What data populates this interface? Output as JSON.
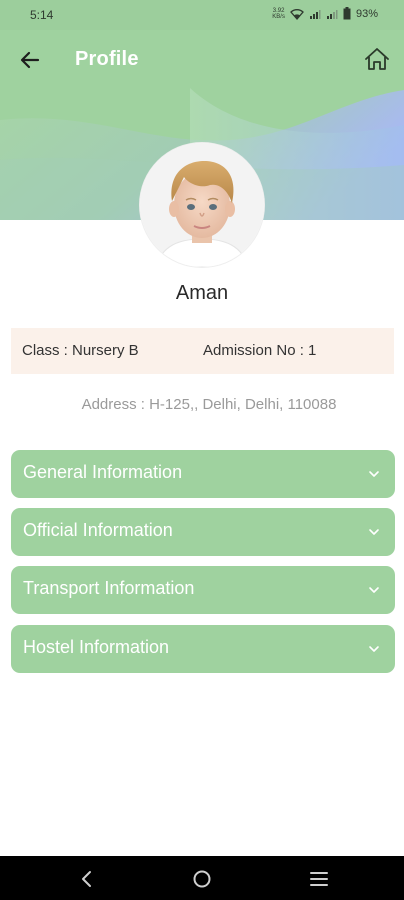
{
  "status_bar": {
    "time": "5:14",
    "net_speed_value": "3.92",
    "net_speed_unit": "KB/s",
    "battery": "93%"
  },
  "header": {
    "title": "Profile",
    "back_icon": "arrow-left-icon",
    "home_icon": "home-icon",
    "colors": {
      "primary": "#9fd29f",
      "gradient_end": "#aabcf5"
    }
  },
  "profile": {
    "name": "Aman",
    "class_text": "Class : Nursery B",
    "admission_text": "Admission No : 1",
    "address_text": "Address : H-125,, Delhi, Delhi, 110088"
  },
  "sections": [
    {
      "label": "General Information"
    },
    {
      "label": "Official Information"
    },
    {
      "label": "Transport Information"
    },
    {
      "label": "Hostel Information"
    }
  ],
  "nav": {
    "back_icon": "nav-back-icon",
    "home_icon": "nav-home-icon",
    "menu_icon": "nav-menu-icon"
  }
}
